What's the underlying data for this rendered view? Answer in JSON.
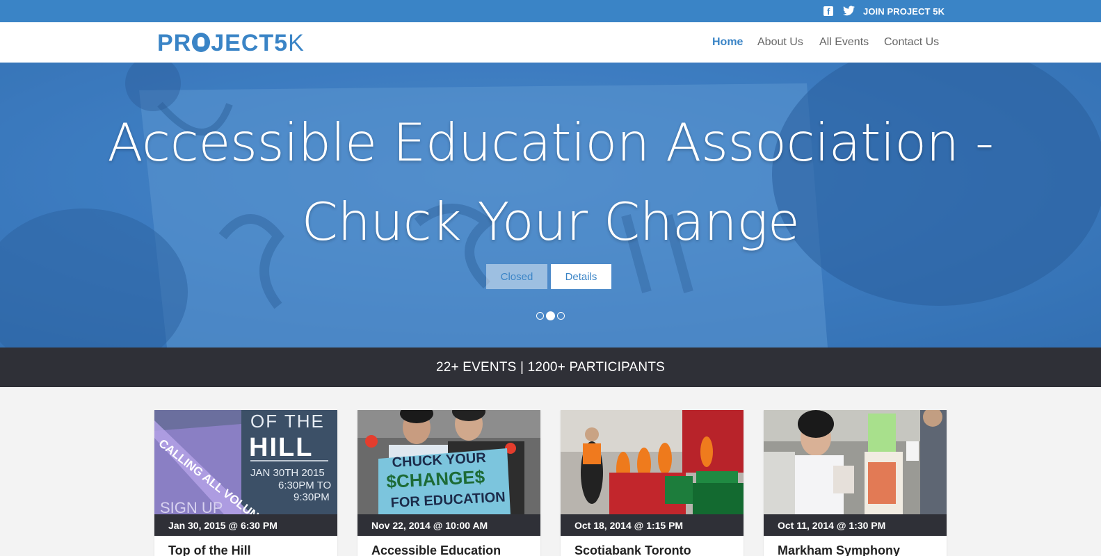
{
  "topbar": {
    "join_label": "JOIN PROJECT 5K",
    "facebook_icon": "facebook-icon",
    "twitter_icon": "twitter-icon",
    "color": "#3a84c6"
  },
  "header": {
    "logo_main": "PR",
    "logo_mid": "JECT5",
    "logo_k": "K",
    "nav": [
      {
        "label": "Home",
        "active": true
      },
      {
        "label": "About Us",
        "active": false
      },
      {
        "label": "All Events",
        "active": false
      },
      {
        "label": "Contact Us",
        "active": false
      }
    ]
  },
  "hero": {
    "title": "Accessible Education Association - Chuck Your Change",
    "closed_label": "Closed",
    "details_label": "Details",
    "slides": 3,
    "active_slide": 2
  },
  "stats": {
    "text": "22+ EVENTS | 1200+ PARTICIPANTS"
  },
  "events": [
    {
      "date": "Jan 30, 2015 @ 6:30 PM",
      "title": "Top of the Hill"
    },
    {
      "date": "Nov 22, 2014 @ 10:00 AM",
      "title": "Accessible Education"
    },
    {
      "date": "Oct 18, 2014 @ 1:15 PM",
      "title": "Scotiabank Toronto"
    },
    {
      "date": "Oct 11, 2014 @ 1:30 PM",
      "title": "Markham Symphony"
    }
  ],
  "poster": {
    "line1": "OF THE",
    "line2": "HILL",
    "line3": "JAN 30TH 2015",
    "line4": "6:30PM TO",
    "line5": "9:30PM",
    "banner": "CALLING ALL VOLUN",
    "signup": "SIGN UP"
  },
  "sign_text": {
    "line1": "CHUCK YOUR",
    "line2": "$CHANGE$",
    "line3": "FOR EDUCATION"
  }
}
